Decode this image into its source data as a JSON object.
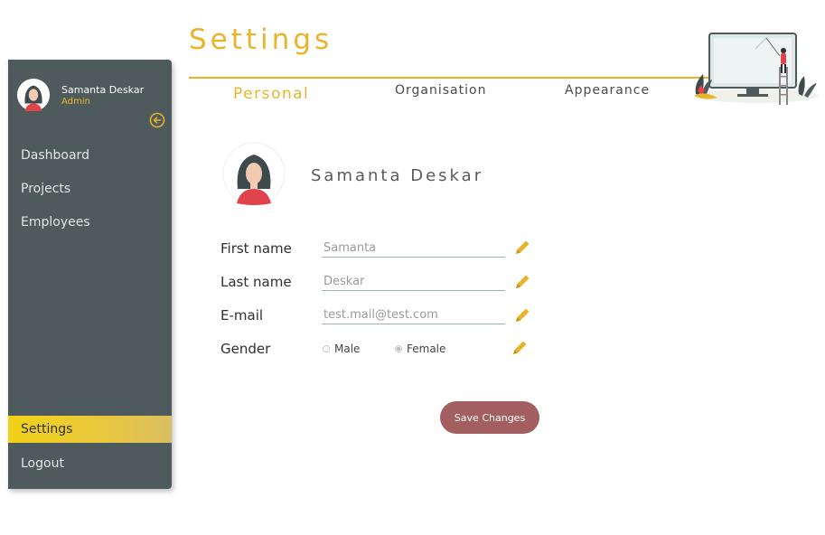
{
  "user": {
    "name": "Samanta Deskar",
    "role": "Admin"
  },
  "sidebar": {
    "nav": [
      {
        "label": "Dashboard"
      },
      {
        "label": "Projects"
      },
      {
        "label": "Employees"
      }
    ],
    "bottom": [
      {
        "label": "Settings",
        "active": true
      },
      {
        "label": "Logout"
      }
    ]
  },
  "header": {
    "title": "Settings",
    "tabs": [
      {
        "label": "Personal",
        "active": true
      },
      {
        "label": "Organisation"
      },
      {
        "label": "Appearance"
      }
    ]
  },
  "profile": {
    "display_name": "Samanta Deskar"
  },
  "form": {
    "first_name": {
      "label": "First name",
      "value": "Samanta"
    },
    "last_name": {
      "label": "Last name",
      "value": "Deskar"
    },
    "email": {
      "label": "E-mail",
      "value": "test.mail@test.com"
    },
    "gender": {
      "label": "Gender",
      "options": [
        "Male",
        "Female"
      ],
      "selected": "Female"
    }
  },
  "actions": {
    "save_label": "Save Changes"
  },
  "colors": {
    "accent": "#e8b52a",
    "sidebar": "#4e5a5c",
    "save_button": "#a35e5f"
  },
  "icons": {
    "collapse": "arrow-left-circle-icon",
    "edit": "pencil-icon"
  }
}
